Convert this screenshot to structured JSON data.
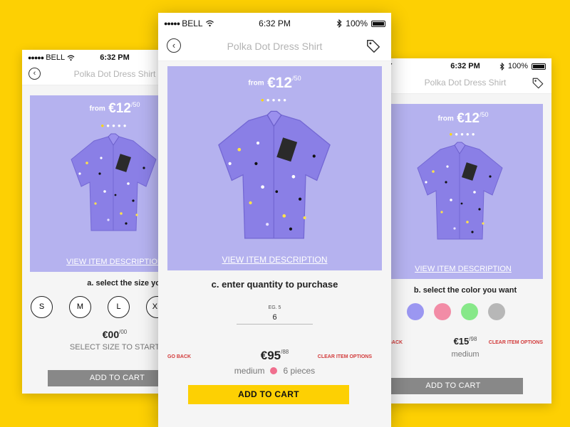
{
  "colors": {
    "background": "#fdd003",
    "product_bg": "#b5b2ef",
    "accent_yellow": "#fdd003",
    "link_red": "#d23b3b",
    "button_gray": "#888888"
  },
  "status": {
    "carrier": "BELL",
    "time": "6:32 PM",
    "battery": "100%"
  },
  "screens": {
    "left": {
      "nav_title": "Polka Dot Dress Shirt",
      "from": "from",
      "price_main": "€12",
      "price_sup": "/50",
      "view_desc": "VIEW ITEM DESCRIPTION",
      "step": "a. select the size you want",
      "sizes": [
        "S",
        "M",
        "L",
        "XL"
      ],
      "price_main2": "€00",
      "price_sup2": "/00",
      "sub": "SELECT SIZE TO START",
      "cart": "ADD TO CART"
    },
    "center": {
      "nav_title": "Polka Dot Dress Shirt",
      "from": "from",
      "price_main": "€12",
      "price_sup": "/50",
      "view_desc": "VIEW ITEM DESCRIPTION",
      "step": "c. enter quantity to purchase",
      "qty_hint": "EG. 5",
      "qty_value": "6",
      "go_back": "GO BACK",
      "clear": "CLEAR ITEM OPTIONS",
      "price_main2": "€95",
      "price_sup2": "/88",
      "size_text": "medium",
      "pieces": "6 pieces",
      "cart": "ADD TO CART"
    },
    "right": {
      "nav_title": "Polka Dot Dress Shirt",
      "from": "from",
      "price_main": "€12",
      "price_sup": "/50",
      "view_desc": "VIEW ITEM DESCRIPTION",
      "step": "b. select the color you want",
      "swatches": [
        "#9b97f1",
        "#f28ca6",
        "#87e889",
        "#b7b7b7"
      ],
      "go_back": "GO BACK",
      "clear": "CLEAR ITEM OPTIONS",
      "price_main2": "€15",
      "price_sup2": "/98",
      "sub": "medium",
      "cart": "ADD TO CART"
    }
  },
  "icons": {
    "back": "back-arrow-icon",
    "tag": "price-tag-icon",
    "wifi": "wifi-icon",
    "bluetooth": "bluetooth-icon",
    "battery": "battery-icon",
    "signal": "signal-dots-icon"
  }
}
